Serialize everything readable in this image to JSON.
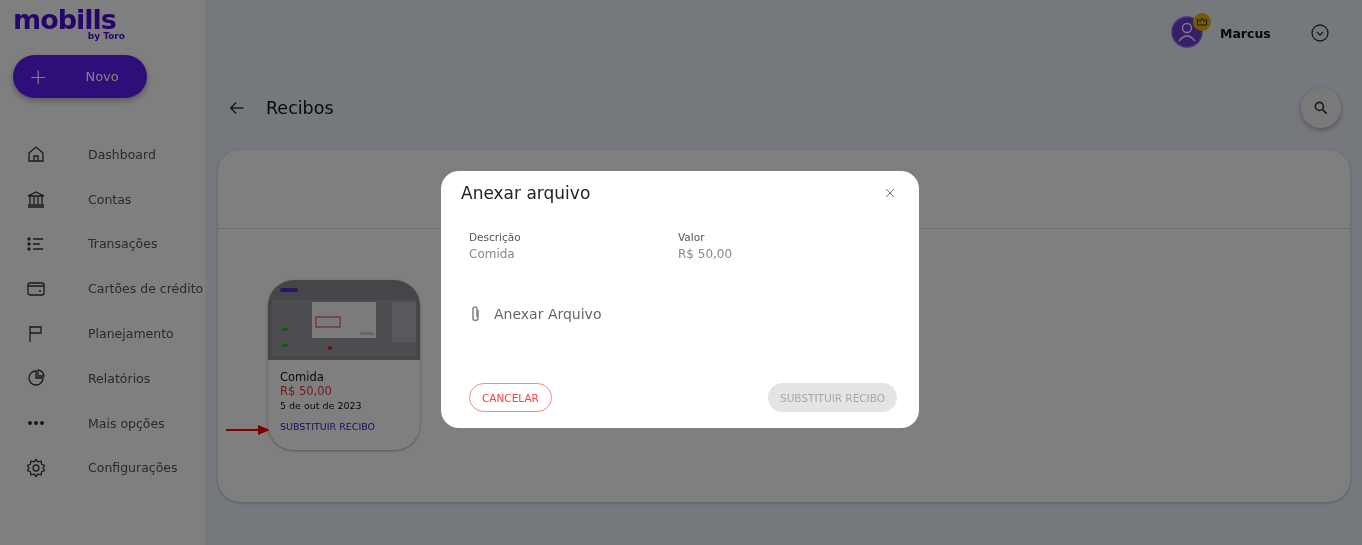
{
  "logo": {
    "name": "mobills",
    "tagline": "by Toro"
  },
  "new_button": {
    "icon": "+",
    "label": "Novo"
  },
  "sidebar": {
    "items": [
      {
        "label": "Dashboard",
        "kind": "home"
      },
      {
        "label": "Contas",
        "kind": "bank"
      },
      {
        "label": "Transações",
        "kind": "list"
      },
      {
        "label": "Cartões de crédito",
        "kind": "card"
      },
      {
        "label": "Planejamento",
        "kind": "flag"
      },
      {
        "label": "Relatórios",
        "kind": "pie"
      },
      {
        "label": "Mais opções",
        "kind": "dots"
      },
      {
        "label": "Configurações",
        "kind": "gear"
      }
    ]
  },
  "user": {
    "name": "Marcus"
  },
  "page": {
    "title": "Recibos"
  },
  "receipts": [
    {
      "description": "Comida",
      "amount": "R$ 50,00",
      "date": "5 de out de 2023",
      "action": "SUBSTITUIR RECIBO",
      "highlighted": true
    }
  ],
  "dialog": {
    "title": "Anexar arquivo",
    "fields": [
      {
        "label": "Descrição",
        "value": "Comida"
      },
      {
        "label": "Valor",
        "value": "R$ 50,00"
      }
    ],
    "attach": "Anexar Arquivo",
    "cancel": {
      "label": "CANCELAR",
      "disabled": false
    },
    "confirm": {
      "label": "SUBSTITUIR RECIBO",
      "disabled": true
    }
  }
}
